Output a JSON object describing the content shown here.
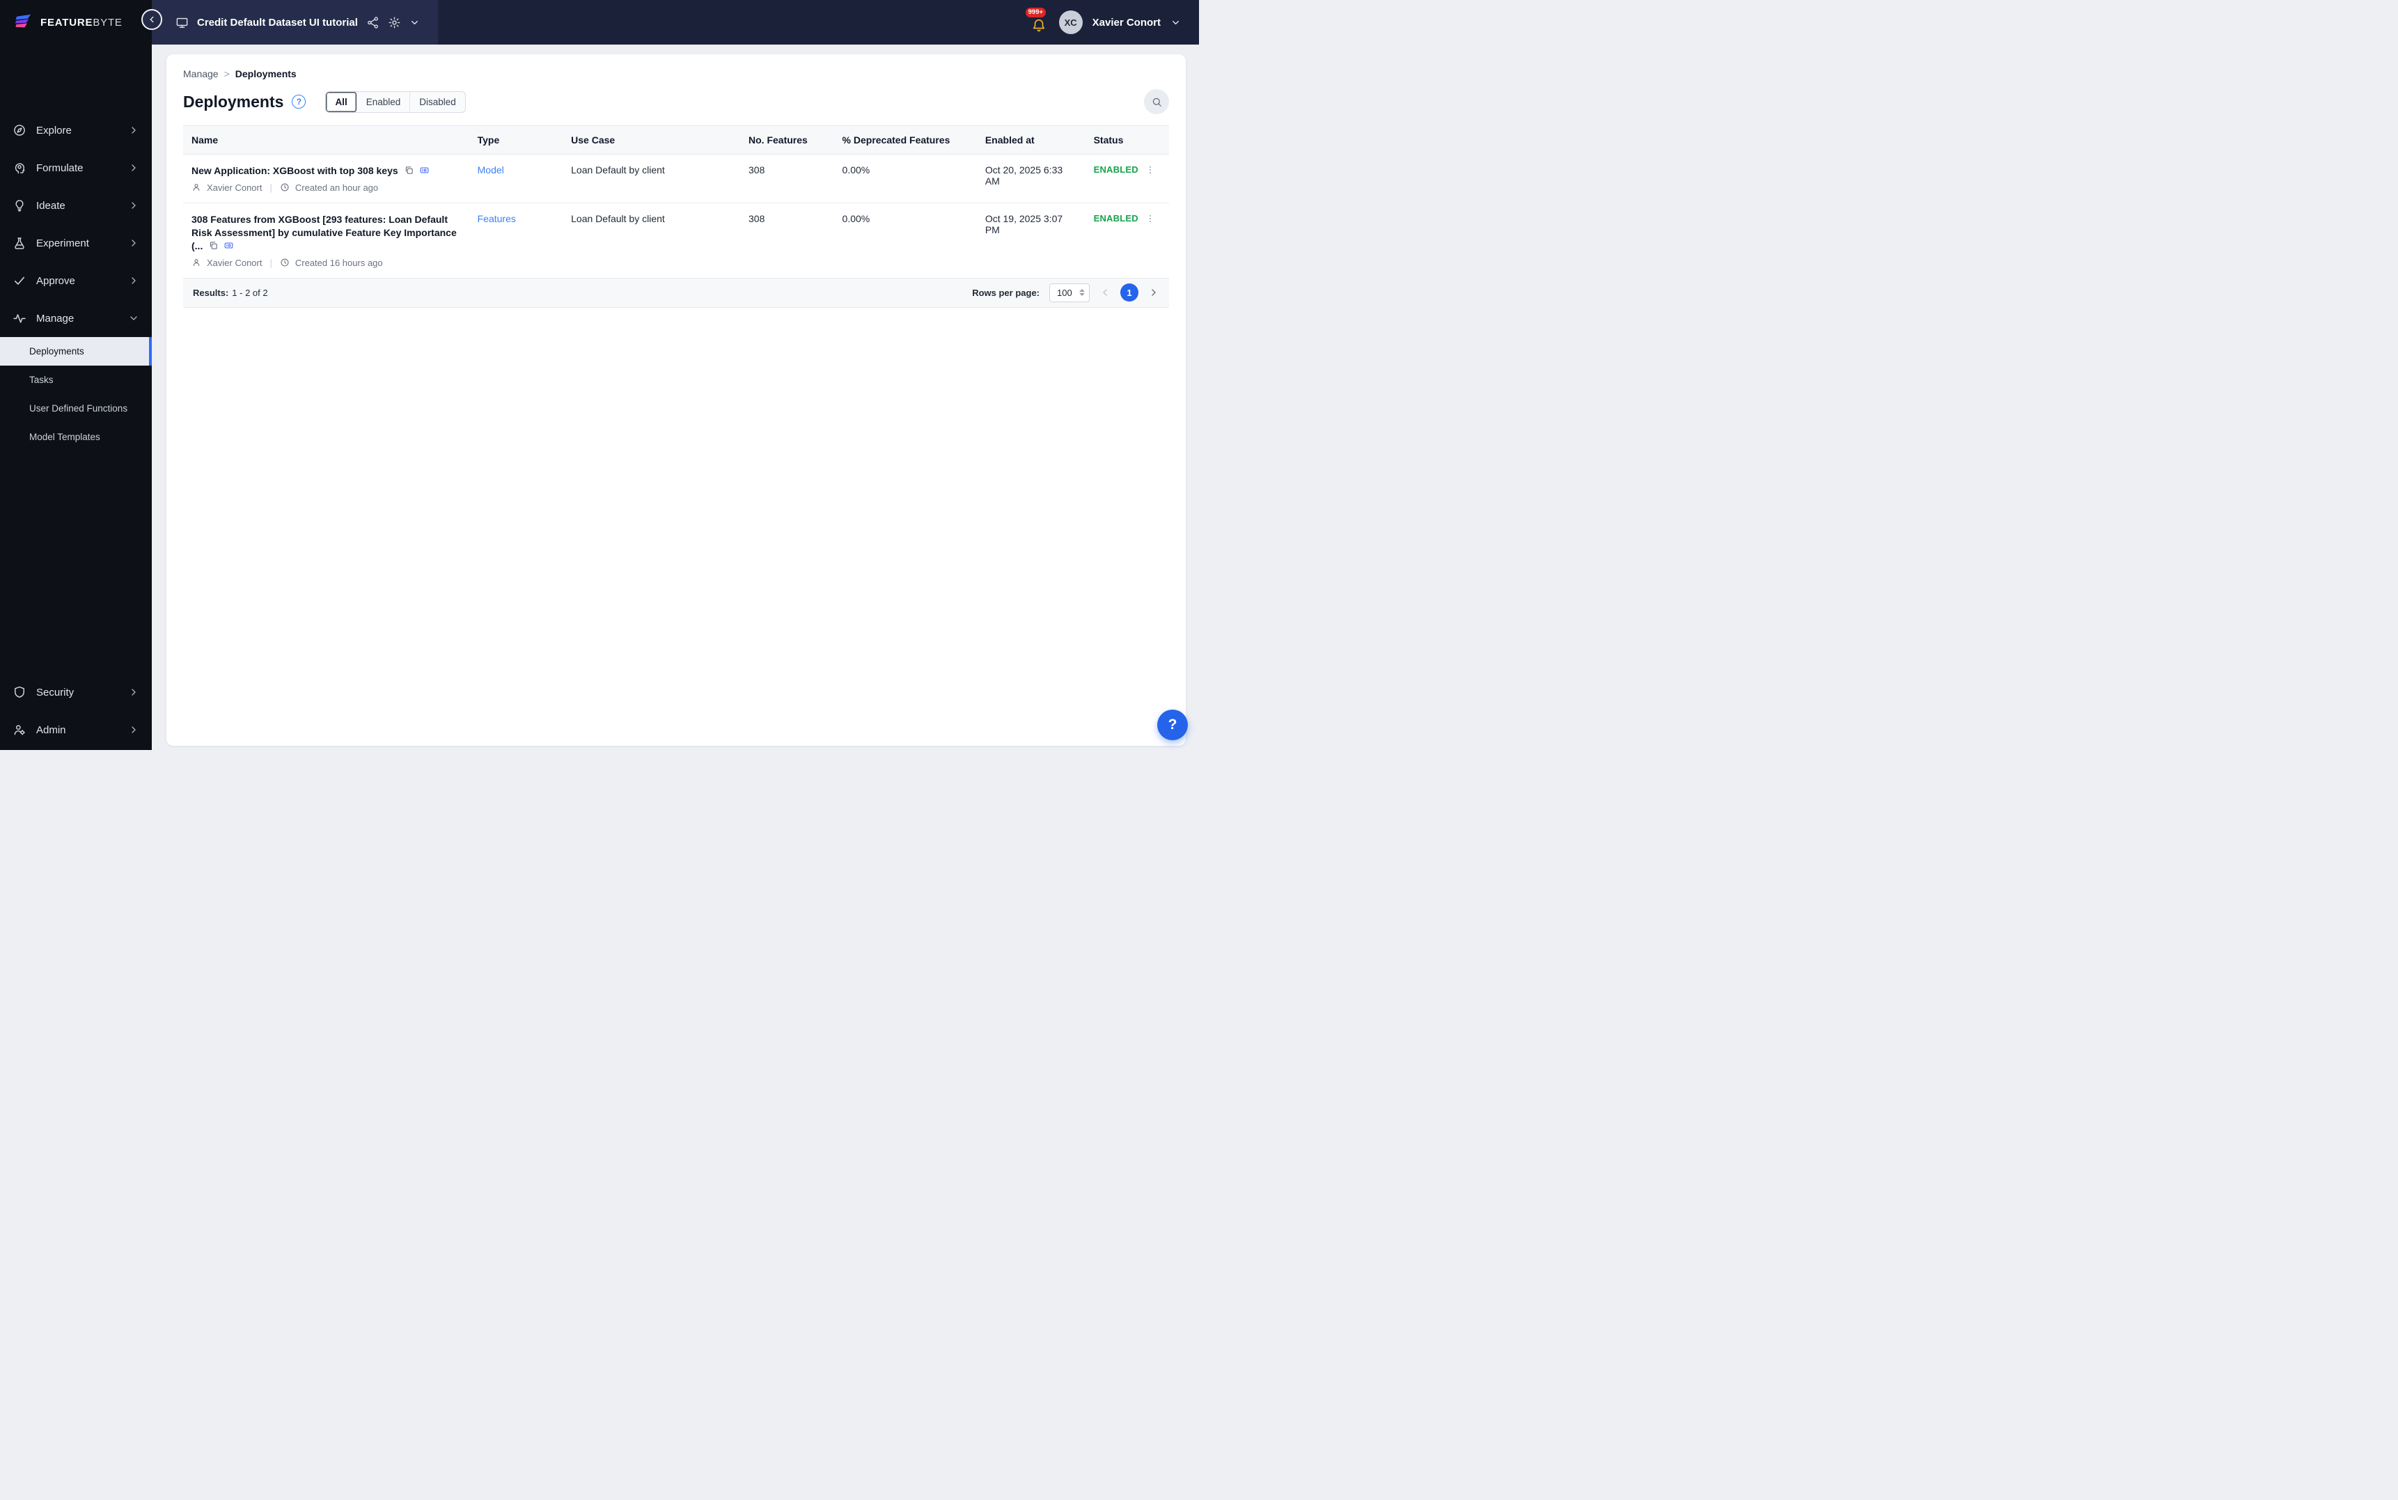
{
  "brand": {
    "logo_text_primary": "FEATURE",
    "logo_text_secondary": "BYTE"
  },
  "topbar": {
    "catalog_title": "Credit Default Dataset UI tutorial",
    "notification_count": "999+",
    "user_initials": "XC",
    "user_name": "Xavier Conort"
  },
  "sidebar": {
    "items": [
      {
        "label": "Explore"
      },
      {
        "label": "Formulate"
      },
      {
        "label": "Ideate"
      },
      {
        "label": "Experiment"
      },
      {
        "label": "Approve"
      },
      {
        "label": "Manage"
      }
    ],
    "manage_submenu": [
      {
        "label": "Deployments"
      },
      {
        "label": "Tasks"
      },
      {
        "label": "User Defined Functions"
      },
      {
        "label": "Model Templates"
      }
    ],
    "bottom_items": [
      {
        "label": "Security"
      },
      {
        "label": "Admin"
      }
    ]
  },
  "page": {
    "breadcrumb_parent": "Manage",
    "breadcrumb_separator": ">",
    "breadcrumb_current": "Deployments",
    "title": "Deployments",
    "help_glyph": "?"
  },
  "filters": {
    "tabs": [
      {
        "label": "All"
      },
      {
        "label": "Enabled"
      },
      {
        "label": "Disabled"
      }
    ]
  },
  "table": {
    "headers": [
      "Name",
      "Type",
      "Use Case",
      "No. Features",
      "% Deprecated Features",
      "Enabled at",
      "Status"
    ],
    "rows": [
      {
        "name": "New Application: XGBoost with top 308 keys",
        "owner": "Xavier Conort",
        "created": "Created an hour ago",
        "type": "Model",
        "use_case": "Loan Default by client",
        "num_features": "308",
        "deprecated_pct": "0.00%",
        "enabled_at": "Oct 20, 2025 6:33 AM",
        "status": "ENABLED"
      },
      {
        "name": "308 Features from XGBoost [293 features: Loan Default Risk Assessment] by cumulative Feature Key Importance (...",
        "owner": "Xavier Conort",
        "created": "Created 16 hours ago",
        "type": "Features",
        "use_case": "Loan Default by client",
        "num_features": "308",
        "deprecated_pct": "0.00%",
        "enabled_at": "Oct 19, 2025 3:07 PM",
        "status": "ENABLED"
      }
    ]
  },
  "footer": {
    "results_label": "Results:",
    "results_value": "1 - 2 of 2",
    "rows_per_page_label": "Rows per page:",
    "rows_per_page_value": "100",
    "current_page": "1"
  },
  "fab": {
    "help_glyph": "?"
  },
  "colors": {
    "accent_blue": "#2563eb",
    "link_blue": "#3b82f6",
    "status_enabled_green": "#16a34a",
    "notification_red": "#dc2626",
    "bell_gold": "#f0b429"
  }
}
